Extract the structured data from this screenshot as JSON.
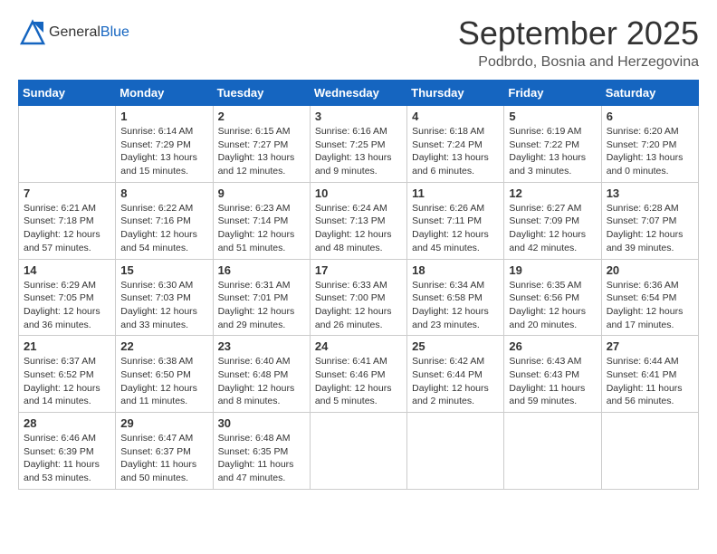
{
  "header": {
    "logo_general": "General",
    "logo_blue": "Blue",
    "month": "September 2025",
    "location": "Podbrdo, Bosnia and Herzegovina"
  },
  "weekdays": [
    "Sunday",
    "Monday",
    "Tuesday",
    "Wednesday",
    "Thursday",
    "Friday",
    "Saturday"
  ],
  "weeks": [
    [
      {
        "day": "",
        "info": ""
      },
      {
        "day": "1",
        "info": "Sunrise: 6:14 AM\nSunset: 7:29 PM\nDaylight: 13 hours\nand 15 minutes."
      },
      {
        "day": "2",
        "info": "Sunrise: 6:15 AM\nSunset: 7:27 PM\nDaylight: 13 hours\nand 12 minutes."
      },
      {
        "day": "3",
        "info": "Sunrise: 6:16 AM\nSunset: 7:25 PM\nDaylight: 13 hours\nand 9 minutes."
      },
      {
        "day": "4",
        "info": "Sunrise: 6:18 AM\nSunset: 7:24 PM\nDaylight: 13 hours\nand 6 minutes."
      },
      {
        "day": "5",
        "info": "Sunrise: 6:19 AM\nSunset: 7:22 PM\nDaylight: 13 hours\nand 3 minutes."
      },
      {
        "day": "6",
        "info": "Sunrise: 6:20 AM\nSunset: 7:20 PM\nDaylight: 13 hours\nand 0 minutes."
      }
    ],
    [
      {
        "day": "7",
        "info": "Sunrise: 6:21 AM\nSunset: 7:18 PM\nDaylight: 12 hours\nand 57 minutes."
      },
      {
        "day": "8",
        "info": "Sunrise: 6:22 AM\nSunset: 7:16 PM\nDaylight: 12 hours\nand 54 minutes."
      },
      {
        "day": "9",
        "info": "Sunrise: 6:23 AM\nSunset: 7:14 PM\nDaylight: 12 hours\nand 51 minutes."
      },
      {
        "day": "10",
        "info": "Sunrise: 6:24 AM\nSunset: 7:13 PM\nDaylight: 12 hours\nand 48 minutes."
      },
      {
        "day": "11",
        "info": "Sunrise: 6:26 AM\nSunset: 7:11 PM\nDaylight: 12 hours\nand 45 minutes."
      },
      {
        "day": "12",
        "info": "Sunrise: 6:27 AM\nSunset: 7:09 PM\nDaylight: 12 hours\nand 42 minutes."
      },
      {
        "day": "13",
        "info": "Sunrise: 6:28 AM\nSunset: 7:07 PM\nDaylight: 12 hours\nand 39 minutes."
      }
    ],
    [
      {
        "day": "14",
        "info": "Sunrise: 6:29 AM\nSunset: 7:05 PM\nDaylight: 12 hours\nand 36 minutes."
      },
      {
        "day": "15",
        "info": "Sunrise: 6:30 AM\nSunset: 7:03 PM\nDaylight: 12 hours\nand 33 minutes."
      },
      {
        "day": "16",
        "info": "Sunrise: 6:31 AM\nSunset: 7:01 PM\nDaylight: 12 hours\nand 29 minutes."
      },
      {
        "day": "17",
        "info": "Sunrise: 6:33 AM\nSunset: 7:00 PM\nDaylight: 12 hours\nand 26 minutes."
      },
      {
        "day": "18",
        "info": "Sunrise: 6:34 AM\nSunset: 6:58 PM\nDaylight: 12 hours\nand 23 minutes."
      },
      {
        "day": "19",
        "info": "Sunrise: 6:35 AM\nSunset: 6:56 PM\nDaylight: 12 hours\nand 20 minutes."
      },
      {
        "day": "20",
        "info": "Sunrise: 6:36 AM\nSunset: 6:54 PM\nDaylight: 12 hours\nand 17 minutes."
      }
    ],
    [
      {
        "day": "21",
        "info": "Sunrise: 6:37 AM\nSunset: 6:52 PM\nDaylight: 12 hours\nand 14 minutes."
      },
      {
        "day": "22",
        "info": "Sunrise: 6:38 AM\nSunset: 6:50 PM\nDaylight: 12 hours\nand 11 minutes."
      },
      {
        "day": "23",
        "info": "Sunrise: 6:40 AM\nSunset: 6:48 PM\nDaylight: 12 hours\nand 8 minutes."
      },
      {
        "day": "24",
        "info": "Sunrise: 6:41 AM\nSunset: 6:46 PM\nDaylight: 12 hours\nand 5 minutes."
      },
      {
        "day": "25",
        "info": "Sunrise: 6:42 AM\nSunset: 6:44 PM\nDaylight: 12 hours\nand 2 minutes."
      },
      {
        "day": "26",
        "info": "Sunrise: 6:43 AM\nSunset: 6:43 PM\nDaylight: 11 hours\nand 59 minutes."
      },
      {
        "day": "27",
        "info": "Sunrise: 6:44 AM\nSunset: 6:41 PM\nDaylight: 11 hours\nand 56 minutes."
      }
    ],
    [
      {
        "day": "28",
        "info": "Sunrise: 6:46 AM\nSunset: 6:39 PM\nDaylight: 11 hours\nand 53 minutes."
      },
      {
        "day": "29",
        "info": "Sunrise: 6:47 AM\nSunset: 6:37 PM\nDaylight: 11 hours\nand 50 minutes."
      },
      {
        "day": "30",
        "info": "Sunrise: 6:48 AM\nSunset: 6:35 PM\nDaylight: 11 hours\nand 47 minutes."
      },
      {
        "day": "",
        "info": ""
      },
      {
        "day": "",
        "info": ""
      },
      {
        "day": "",
        "info": ""
      },
      {
        "day": "",
        "info": ""
      }
    ]
  ]
}
